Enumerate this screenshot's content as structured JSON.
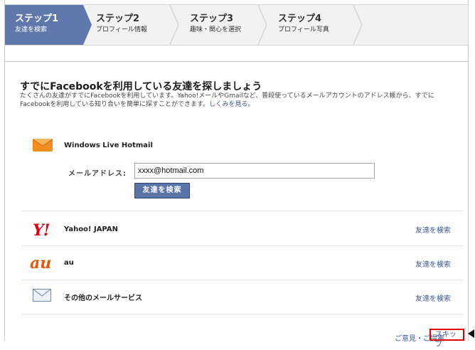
{
  "steps": [
    {
      "title": "ステップ1",
      "subtitle": "友達を検索",
      "active": true
    },
    {
      "title": "ステップ2",
      "subtitle": "プロフィール情報",
      "active": false
    },
    {
      "title": "ステップ3",
      "subtitle": "趣味・関心を選択",
      "active": false
    },
    {
      "title": "ステップ4",
      "subtitle": "プロフィール写真",
      "active": false
    }
  ],
  "main": {
    "title": "すでにFacebookを利用している友達を探しましょう",
    "description": "たくさんの友達がすでにFacebookを利用しています。Yahoo!メールやGmailなど、普段使っているメールアカウントのアドレス帳から、すでにFacebookを利用している知り合いを簡単に探すことができます。",
    "learn_more": "しくみを見る。"
  },
  "hotmail": {
    "name": "Windows Live Hotmail",
    "email_label": "メールアドレス:",
    "email_value": "xxxx@hotmail.com",
    "search_button": "友達を検索"
  },
  "services": [
    {
      "logo": "Y!",
      "name": "Yahoo! JAPAN",
      "link": "友達を検索"
    },
    {
      "logo": "au",
      "name": "au",
      "link": "友達を検索"
    },
    {
      "logo": "envelope-icon",
      "name": "その他のメールサービス",
      "link": "友達を検索"
    }
  ],
  "footer": {
    "feedback": "ご意見・ご提案",
    "skip": "スキップ"
  },
  "colors": {
    "active_step": "#5f78ab",
    "link": "#3b5998",
    "button": "#5b74a8",
    "highlight": "#e00000"
  }
}
